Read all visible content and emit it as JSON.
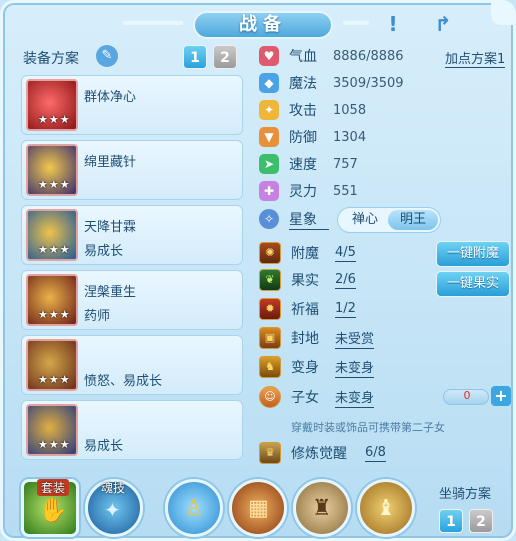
{
  "header": {
    "title": "战备"
  },
  "left": {
    "title": "装备方案",
    "pages": [
      "1",
      "2"
    ],
    "plans": [
      {
        "name": "群体净心",
        "sub": "",
        "stars": "★★★",
        "color": "#c7262d"
      },
      {
        "name": "绵里藏针",
        "sub": "",
        "stars": "★★★",
        "color": "#4b3580"
      },
      {
        "name": "天降甘霖",
        "sub": "易成长",
        "stars": "★★★",
        "color": "#2c6fb0"
      },
      {
        "name": "涅槃重生",
        "sub": "药师",
        "stars": "★★★",
        "color": "#7a2b23"
      },
      {
        "name": "",
        "sub": "愤怒、易成长",
        "stars": "★★★",
        "color": "#7b3a26"
      },
      {
        "name": "",
        "sub": "易成长",
        "stars": "★★★",
        "color": "#3a4a88"
      }
    ]
  },
  "stats": {
    "add_point_plan": "加点方案1",
    "items": [
      {
        "label": "气血",
        "value": "8886/8886",
        "icon": "heart-icon",
        "color": "#e05a6d"
      },
      {
        "label": "魔法",
        "value": "3509/3509",
        "icon": "mana-icon",
        "color": "#4aa3e6"
      },
      {
        "label": "攻击",
        "value": "1058",
        "icon": "attack-icon",
        "color": "#f0b63a"
      },
      {
        "label": "防御",
        "value": "1304",
        "icon": "defense-icon",
        "color": "#e8913a"
      },
      {
        "label": "速度",
        "value": "757",
        "icon": "speed-icon",
        "color": "#3cbf6c"
      },
      {
        "label": "灵力",
        "value": "551",
        "icon": "spirit-icon",
        "color": "#c682e3"
      }
    ]
  },
  "xingxiang": {
    "label": "星象",
    "options": [
      "禅心",
      "明王"
    ],
    "selected": "明王"
  },
  "rows": [
    {
      "label": "附魔",
      "value": "4/5"
    },
    {
      "label": "果实",
      "value": "2/6"
    },
    {
      "label": "祈福",
      "value": "1/2"
    },
    {
      "label": "封地",
      "value": "未受赏"
    },
    {
      "label": "变身",
      "value": "未变身"
    },
    {
      "label": "子女",
      "value": "未变身"
    },
    {
      "label": "修炼觉醒",
      "value": "6/8"
    }
  ],
  "actions": {
    "enchant": "一键附魔",
    "fruit": "一键果实"
  },
  "child": {
    "count": "0",
    "hint": "穿戴时装或饰品可携带第二子女"
  },
  "bottom": {
    "tags": [
      "套装",
      "魂技"
    ],
    "mount_title": "坐骑方案",
    "mount_pages": [
      "1",
      "2"
    ]
  }
}
